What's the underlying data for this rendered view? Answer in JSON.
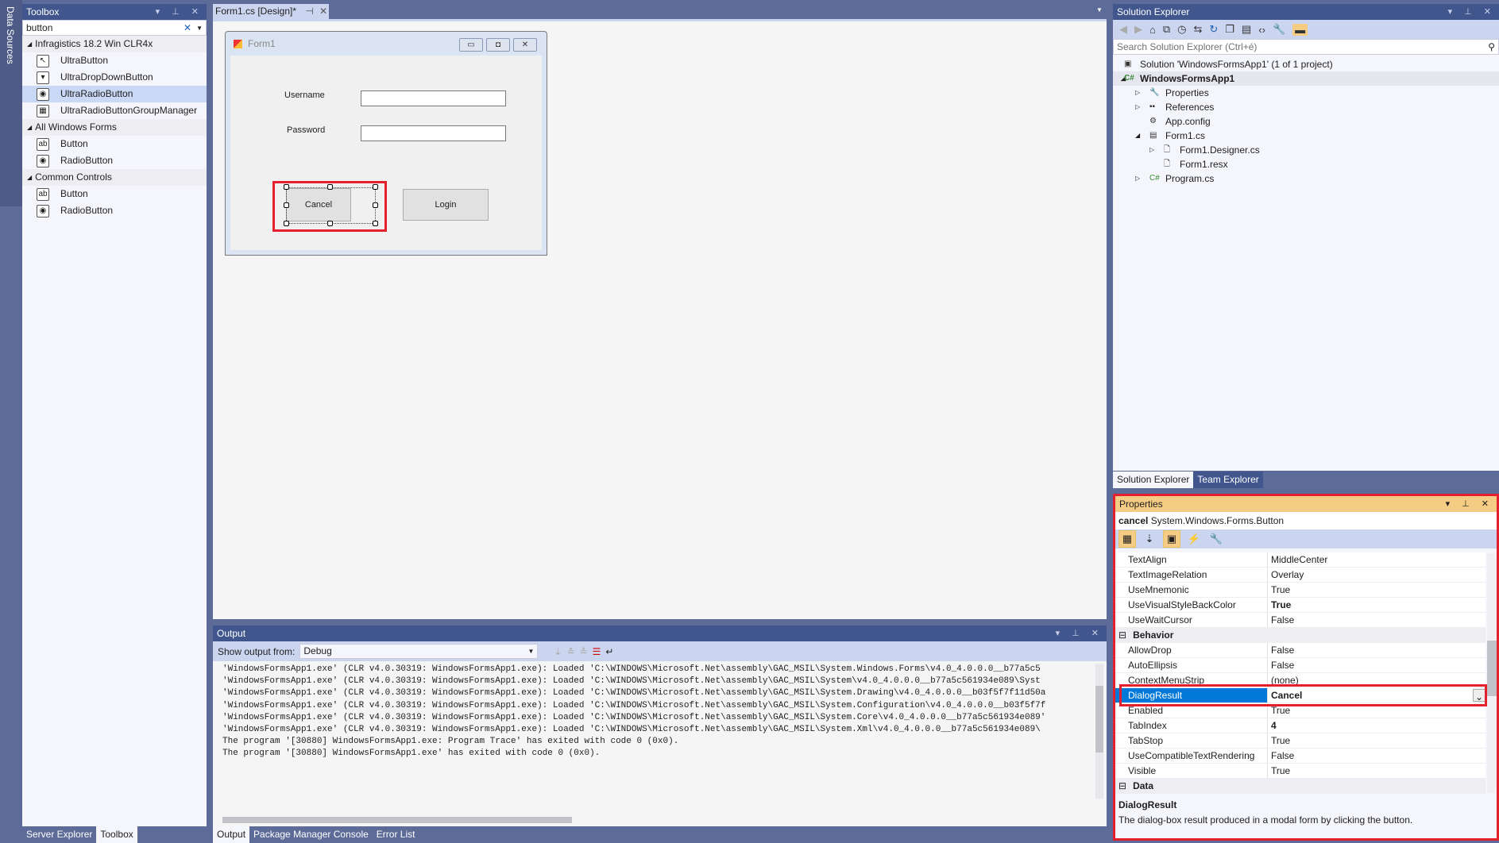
{
  "left_strip": {
    "data_sources": "Data Sources"
  },
  "toolbox": {
    "title": "Toolbox",
    "search_value": "button",
    "groups": [
      {
        "label": "Infragistics 18.2 Win CLR4x",
        "items": [
          {
            "label": "UltraButton",
            "icon": "ultrabutton-icon"
          },
          {
            "label": "UltraDropDownButton",
            "icon": "dropdown-button-icon"
          },
          {
            "label": "UltraRadioButton",
            "icon": "radio-button-icon",
            "selected": true
          },
          {
            "label": "UltraRadioButtonGroupManager",
            "icon": "group-manager-icon"
          }
        ]
      },
      {
        "label": "All Windows Forms",
        "items": [
          {
            "label": "Button",
            "icon": "button-icon"
          },
          {
            "label": "RadioButton",
            "icon": "radio-icon"
          }
        ]
      },
      {
        "label": "Common Controls",
        "items": [
          {
            "label": "Button",
            "icon": "button-icon"
          },
          {
            "label": "RadioButton",
            "icon": "radio-icon"
          }
        ]
      }
    ],
    "bottom_tabs": [
      "Server Explorer",
      "Toolbox"
    ]
  },
  "document": {
    "tab_label": "Form1.cs [Design]*",
    "form": {
      "title": "Form1",
      "username_label": "Username",
      "password_label": "Password",
      "cancel_label": "Cancel",
      "login_label": "Login"
    }
  },
  "output": {
    "title": "Output",
    "show_from_label": "Show output from:",
    "source": "Debug",
    "lines": [
      "'WindowsFormsApp1.exe' (CLR v4.0.30319: WindowsFormsApp1.exe): Loaded 'C:\\WINDOWS\\Microsoft.Net\\assembly\\GAC_MSIL\\System.Windows.Forms\\v4.0_4.0.0.0__b77a5c5",
      "'WindowsFormsApp1.exe' (CLR v4.0.30319: WindowsFormsApp1.exe): Loaded 'C:\\WINDOWS\\Microsoft.Net\\assembly\\GAC_MSIL\\System\\v4.0_4.0.0.0__b77a5c561934e089\\Syst",
      "'WindowsFormsApp1.exe' (CLR v4.0.30319: WindowsFormsApp1.exe): Loaded 'C:\\WINDOWS\\Microsoft.Net\\assembly\\GAC_MSIL\\System.Drawing\\v4.0_4.0.0.0__b03f5f7f11d50a",
      "'WindowsFormsApp1.exe' (CLR v4.0.30319: WindowsFormsApp1.exe): Loaded 'C:\\WINDOWS\\Microsoft.Net\\assembly\\GAC_MSIL\\System.Configuration\\v4.0_4.0.0.0__b03f5f7f",
      "'WindowsFormsApp1.exe' (CLR v4.0.30319: WindowsFormsApp1.exe): Loaded 'C:\\WINDOWS\\Microsoft.Net\\assembly\\GAC_MSIL\\System.Core\\v4.0_4.0.0.0__b77a5c561934e089'",
      "'WindowsFormsApp1.exe' (CLR v4.0.30319: WindowsFormsApp1.exe): Loaded 'C:\\WINDOWS\\Microsoft.Net\\assembly\\GAC_MSIL\\System.Xml\\v4.0_4.0.0.0__b77a5c561934e089\\",
      "The program '[30880] WindowsFormsApp1.exe: Program Trace' has exited with code 0 (0x0).",
      "The program '[30880] WindowsFormsApp1.exe' has exited with code 0 (0x0)."
    ],
    "bottom_tabs": [
      "Output",
      "Package Manager Console",
      "Error List"
    ]
  },
  "solution_explorer": {
    "title": "Solution Explorer",
    "search_placeholder": "Search Solution Explorer (Ctrl+é)",
    "tree": [
      {
        "label": "Solution 'WindowsFormsApp1' (1 of 1 project)",
        "depth": 0,
        "icon": "solution-icon"
      },
      {
        "label": "WindowsFormsApp1",
        "depth": 0,
        "expanded": true,
        "icon": "csharp-project-icon",
        "bold": true
      },
      {
        "label": "Properties",
        "depth": 1,
        "expander": "collapsed",
        "icon": "wrench-icon"
      },
      {
        "label": "References",
        "depth": 1,
        "expander": "collapsed",
        "icon": "references-icon"
      },
      {
        "label": "App.config",
        "depth": 1,
        "icon": "config-icon"
      },
      {
        "label": "Form1.cs",
        "depth": 1,
        "expander": "expanded",
        "icon": "form-icon"
      },
      {
        "label": "Form1.Designer.cs",
        "depth": 2,
        "expander": "collapsed",
        "icon": "file-icon"
      },
      {
        "label": "Form1.resx",
        "depth": 2,
        "icon": "file-icon"
      },
      {
        "label": "Program.cs",
        "depth": 1,
        "expander": "collapsed",
        "icon": "csharp-file-icon"
      }
    ],
    "bottom_tabs": [
      "Solution Explorer",
      "Team Explorer"
    ]
  },
  "properties": {
    "title": "Properties",
    "object_name": "cancel",
    "object_type": "System.Windows.Forms.Button",
    "rows": [
      {
        "name": "TextAlign",
        "value": "MiddleCenter"
      },
      {
        "name": "TextImageRelation",
        "value": "Overlay"
      },
      {
        "name": "UseMnemonic",
        "value": "True"
      },
      {
        "name": "UseVisualStyleBackColor",
        "value": "True",
        "bold": true
      },
      {
        "name": "UseWaitCursor",
        "value": "False"
      },
      {
        "category": "Behavior"
      },
      {
        "name": "AllowDrop",
        "value": "False"
      },
      {
        "name": "AutoEllipsis",
        "value": "False"
      },
      {
        "name": "ContextMenuStrip",
        "value": "(none)"
      },
      {
        "name": "DialogResult",
        "value": "Cancel",
        "bold": true,
        "selected": true
      },
      {
        "name": "Enabled",
        "value": "True"
      },
      {
        "name": "TabIndex",
        "value": "4",
        "bold": true
      },
      {
        "name": "TabStop",
        "value": "True"
      },
      {
        "name": "UseCompatibleTextRendering",
        "value": "False"
      },
      {
        "name": "Visible",
        "value": "True"
      },
      {
        "category": "Data"
      }
    ],
    "description_title": "DialogResult",
    "description": "The dialog-box result produced in a modal form by clicking the button."
  },
  "colors": {
    "chrome": "#5d6b99",
    "title_bar": "#40568d",
    "active_title": "#f5cc84",
    "selection": "#0078d7",
    "highlight_border": "#e5202e"
  }
}
